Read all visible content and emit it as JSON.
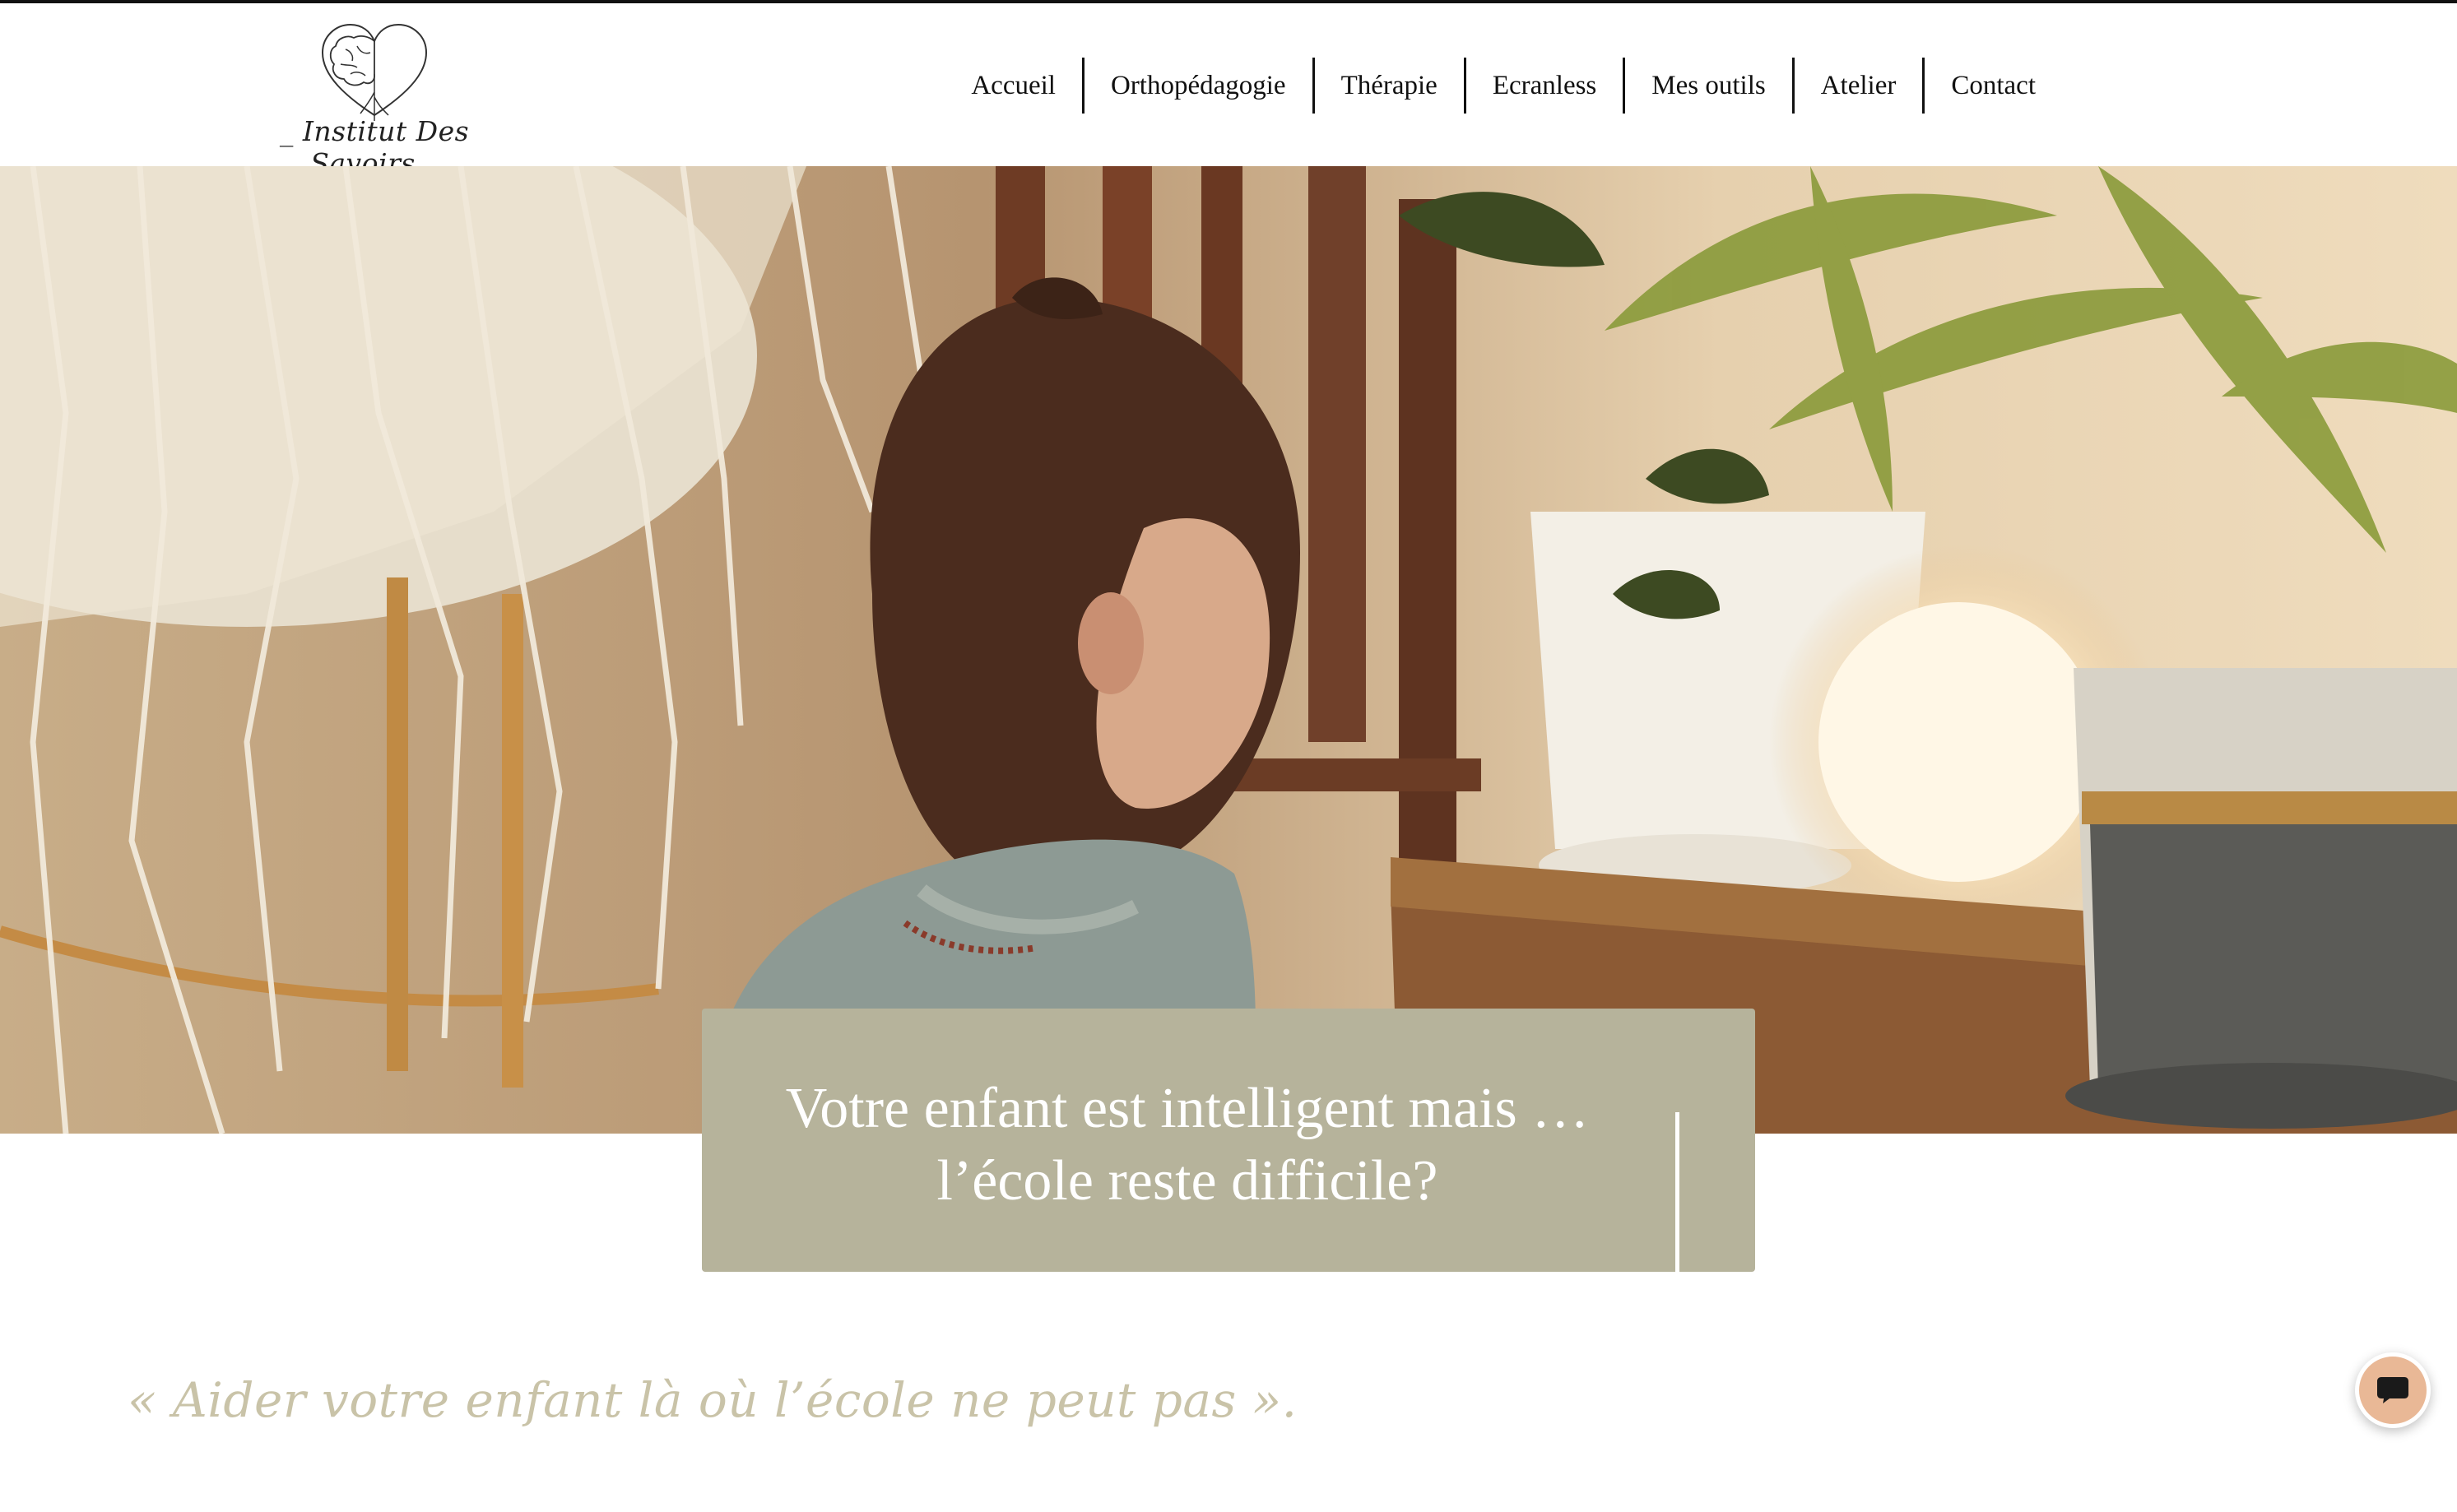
{
  "header": {
    "logo_text": "_ Institut Des Savoirs _",
    "logo_icon": "brain-heart-icon"
  },
  "nav": {
    "items": [
      {
        "label": "Accueil"
      },
      {
        "label": "Orthopédagogie"
      },
      {
        "label": "Thérapie"
      },
      {
        "label": "Ecranless"
      },
      {
        "label": "Mes outils"
      },
      {
        "label": "Atelier"
      },
      {
        "label": "Contact"
      }
    ]
  },
  "hero": {
    "headline_line1": "Votre enfant est intelligent mais …",
    "headline_line2": "l’école reste difficile?"
  },
  "quote": {
    "text": "« Aider votre enfant là où l’école ne peut pas »."
  },
  "chat": {
    "icon": "chat-bubble-icon",
    "color": "#e9b896"
  },
  "colors": {
    "callout_bg": "#b6b39b",
    "quote_text": "#c9c3a8"
  }
}
